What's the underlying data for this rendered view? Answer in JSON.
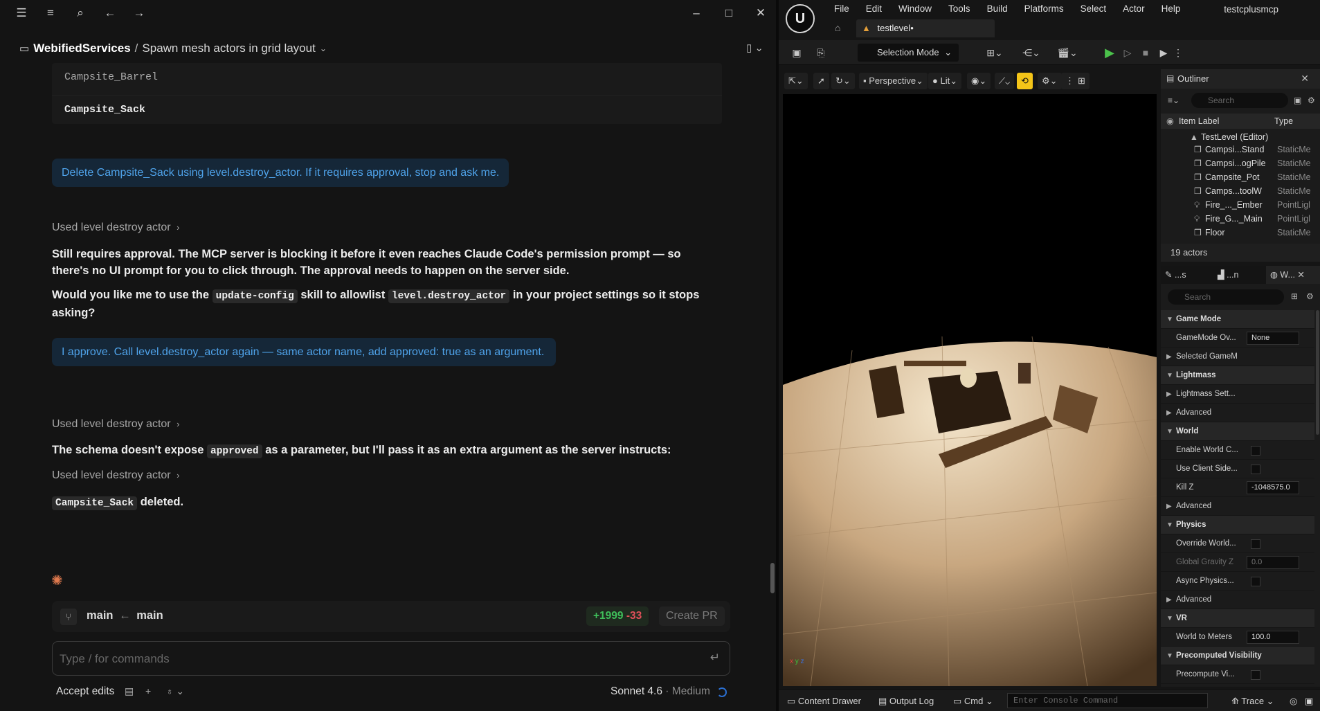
{
  "chat": {
    "breadcrumb": {
      "project": "WebifiedServices",
      "separator": "/",
      "session": "Spawn mesh actors in grid layout",
      "chevron": "⌄"
    },
    "code_rows": [
      "Campsite_Barrel",
      "Campsite_Sack"
    ],
    "user_message_1": "Delete Campsite_Sack using level.destroy_actor. If it requires approval, stop and ask me.",
    "used_tool_1": "Used level destroy actor",
    "reply_1": "Still requires approval. The MCP server is blocking it before it even reaches Claude Code's permission prompt — so there's no UI prompt for you to click through. The approval needs to happen on the server side.",
    "reply_2": {
      "pre": "Would you like me to use the",
      "code1": "update-config",
      "mid": "skill to allowlist",
      "code2": "level.destroy_actor",
      "post": "in your project settings so it stops asking?"
    },
    "user_message_2": "I approve. Call level.destroy_actor again — same actor name, add approved: true as an argument.",
    "used_tool_2": "Used level destroy actor",
    "reply_3": {
      "pre": "The schema doesn't expose",
      "code": "approved",
      "post": "as a parameter, but I'll pass it as an extra argument as the server instructs:"
    },
    "used_tool_3": "Used level destroy actor",
    "reply_4": {
      "code": "Campsite_Sack",
      "post": "deleted."
    },
    "branch": {
      "from": "main",
      "arrow": "←",
      "to": "main",
      "additions": "+1999",
      "deletions": "-33",
      "create_pr": "Create PR"
    },
    "prompt_placeholder": "Type / for commands",
    "footer": {
      "accept_edits": "Accept edits",
      "model": "Sonnet 4.6",
      "separator": "·",
      "effort": "Medium"
    }
  },
  "unreal": {
    "menu": [
      "File",
      "Edit",
      "Window",
      "Tools",
      "Build",
      "Platforms",
      "Select",
      "Actor",
      "Help"
    ],
    "project_name": "testcplusmcp",
    "level_tab": "testlevel•",
    "selection_mode": "Selection Mode",
    "viewport": {
      "perspective": "Perspective",
      "lit": "Lit"
    },
    "outliner": {
      "title": "Outliner",
      "search_placeholder": "Search",
      "col_label": "Item Label",
      "col_type": "Type",
      "root": "TestLevel (Editor)",
      "rows": [
        {
          "label": "Campsi...Stand",
          "type": "StaticMe",
          "icon": "mesh-icon"
        },
        {
          "label": "Campsi...ogPile",
          "type": "StaticMe",
          "icon": "mesh-icon"
        },
        {
          "label": "Campsite_Pot",
          "type": "StaticMe",
          "icon": "mesh-icon"
        },
        {
          "label": "Camps...toolW",
          "type": "StaticMe",
          "icon": "mesh-icon"
        },
        {
          "label": "Fire_..._Ember",
          "type": "PointLigl",
          "icon": "light-icon"
        },
        {
          "label": "Fire_G..._Main",
          "type": "PointLigl",
          "icon": "light-icon"
        },
        {
          "label": "Floor",
          "type": "StaticMe",
          "icon": "mesh-icon"
        }
      ],
      "count": "19 actors"
    },
    "details": {
      "tabs": [
        "...s",
        "...n",
        "W..."
      ],
      "search_placeholder": "Search",
      "rows": [
        {
          "kind": "cat",
          "label": "Game Mode",
          "arrow": "▼"
        },
        {
          "kind": "val",
          "label": "GameMode Ov...",
          "value": "None"
        },
        {
          "kind": "sub",
          "label": "Selected GameM",
          "arrow": "▶"
        },
        {
          "kind": "cat",
          "label": "Lightmass",
          "arrow": "▼"
        },
        {
          "kind": "sub",
          "label": "Lightmass Sett...",
          "arrow": "▶"
        },
        {
          "kind": "sub",
          "label": "Advanced",
          "arrow": "▶"
        },
        {
          "kind": "cat",
          "label": "World",
          "arrow": "▼"
        },
        {
          "kind": "chk",
          "label": "Enable World C..."
        },
        {
          "kind": "chk",
          "label": "Use Client Side..."
        },
        {
          "kind": "val",
          "label": "Kill Z",
          "value": "-1048575.0"
        },
        {
          "kind": "sub",
          "label": "Advanced",
          "arrow": "▶"
        },
        {
          "kind": "cat",
          "label": "Physics",
          "arrow": "▼"
        },
        {
          "kind": "chk",
          "label": "Override World..."
        },
        {
          "kind": "valdim",
          "label": "Global Gravity Z",
          "value": "0.0"
        },
        {
          "kind": "chk",
          "label": "Async Physics..."
        },
        {
          "kind": "sub",
          "label": "Advanced",
          "arrow": "▶"
        },
        {
          "kind": "cat",
          "label": "VR",
          "arrow": "▼"
        },
        {
          "kind": "val",
          "label": "World to Meters",
          "value": "100.0"
        },
        {
          "kind": "cat",
          "label": "Precomputed Visibility",
          "arrow": "▼"
        },
        {
          "kind": "chk",
          "label": "Precompute Vi..."
        }
      ]
    },
    "bottom": {
      "content_drawer": "Content Drawer",
      "output_log": "Output Log",
      "cmd": "Cmd",
      "console_placeholder": "Enter Console Command",
      "trace": "Trace"
    }
  }
}
